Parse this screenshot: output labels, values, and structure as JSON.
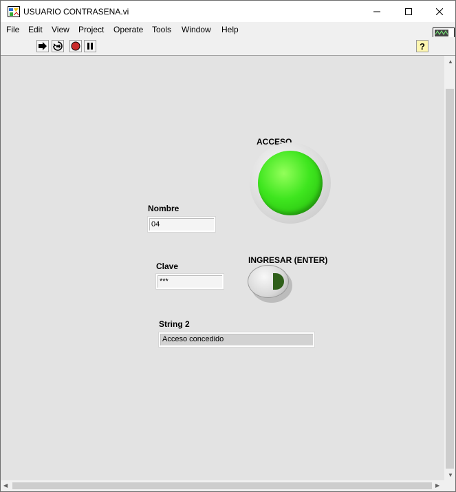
{
  "window": {
    "title": "USUARIO CONTRASENA.vi"
  },
  "menu": [
    "File",
    "Edit",
    "View",
    "Project",
    "Operate",
    "Tools",
    "Window",
    "Help"
  ],
  "vi_icon_number": "1",
  "controls": {
    "nombre": {
      "label": "Nombre",
      "value": "04"
    },
    "clave": {
      "label": "Clave",
      "value": "***"
    },
    "acceso": {
      "label": "ACCESO",
      "state": "on",
      "color": "#3fe61f"
    },
    "ingresar": {
      "label": "INGRESAR (ENTER)"
    },
    "string2": {
      "label": "String 2",
      "value": "Acceso concedido"
    }
  }
}
